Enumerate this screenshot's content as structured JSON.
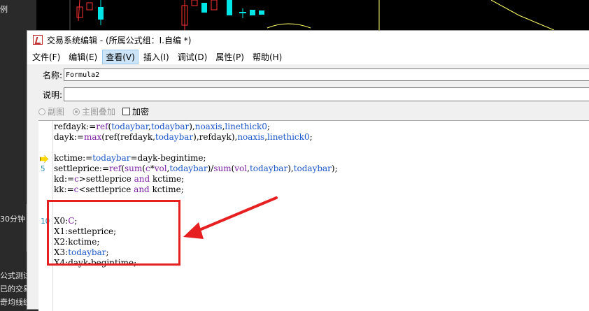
{
  "left_panel": {
    "items": [
      "例",
      "30分钟",
      "公式测试",
      "已的交易",
      "奇均线统"
    ],
    "collapse_glyph": "‹"
  },
  "chart": {
    "background": "#000000",
    "up_color": "#ff3232",
    "down_color": "#00e5e5",
    "line_color": "#ffff66"
  },
  "dialog": {
    "title": "交易系统编辑 - (所属公式组：I.自编 *)",
    "menu": [
      {
        "label": "文件(F)",
        "active": false
      },
      {
        "label": "编辑(E)",
        "active": false
      },
      {
        "label": "查看(V)",
        "active": true
      },
      {
        "label": "插入(I)",
        "active": false
      },
      {
        "label": "调试(D)",
        "active": false
      },
      {
        "label": "属性(P)",
        "active": false
      },
      {
        "label": "帮助(H)",
        "active": false
      }
    ],
    "name_label": "名称:",
    "name_value": "Formula2",
    "desc_label": "说明:",
    "desc_value": "",
    "option_sub_chart": "副图",
    "option_main_overlay": "主图叠加",
    "option_encrypt": "加密"
  },
  "editor": {
    "gutter_numbers": [
      {
        "text": "5"
      },
      {
        "text": "10"
      }
    ],
    "current_line_marker": "arrow-icon",
    "lines": [
      [
        [
          "refdayk:=",
          ""
        ],
        [
          "ref",
          "kw"
        ],
        [
          "(",
          ""
        ],
        [
          "todaybar",
          "id"
        ],
        [
          ",",
          ""
        ],
        [
          "todaybar",
          "id"
        ],
        [
          "),",
          ""
        ],
        [
          "noaxis",
          "id"
        ],
        [
          ",",
          ""
        ],
        [
          "linethick0",
          "id"
        ],
        [
          ";",
          ""
        ]
      ],
      [
        [
          "dayk:=",
          ""
        ],
        [
          "max",
          "kw"
        ],
        [
          "(ref(refdayk,",
          ""
        ],
        [
          "todaybar",
          "id"
        ],
        [
          "),refdayk),",
          ""
        ],
        [
          "noaxis",
          "id"
        ],
        [
          ",",
          ""
        ],
        [
          "linethick0",
          "id"
        ],
        [
          ";",
          ""
        ]
      ],
      [
        [
          "",
          ""
        ]
      ],
      [
        [
          "kctime:=",
          ""
        ],
        [
          "todaybar",
          "id"
        ],
        [
          "=dayk-begintime;",
          ""
        ]
      ],
      [
        [
          "settleprice:=",
          ""
        ],
        [
          "ref",
          "kw"
        ],
        [
          "(",
          ""
        ],
        [
          "sum",
          "kw"
        ],
        [
          "(",
          ""
        ],
        [
          "c",
          "kw"
        ],
        [
          "*",
          ""
        ],
        [
          "vol",
          "kw"
        ],
        [
          ",",
          ""
        ],
        [
          "todaybar",
          "id"
        ],
        [
          ")/",
          ""
        ],
        [
          "sum",
          "kw"
        ],
        [
          "(",
          ""
        ],
        [
          "vol",
          "kw"
        ],
        [
          ",",
          ""
        ],
        [
          "todaybar",
          "id"
        ],
        [
          "),",
          ""
        ],
        [
          "todaybar",
          "id"
        ],
        [
          ");",
          ""
        ]
      ],
      [
        [
          "kd:=",
          ""
        ],
        [
          "c",
          "kw"
        ],
        [
          ">settleprice ",
          ""
        ],
        [
          "and",
          "kw"
        ],
        [
          " kctime;",
          ""
        ]
      ],
      [
        [
          "kk:=",
          ""
        ],
        [
          "c",
          "kw"
        ],
        [
          "<settleprice ",
          ""
        ],
        [
          "and",
          "kw"
        ],
        [
          " kctime;",
          ""
        ]
      ],
      [
        [
          "",
          ""
        ]
      ],
      [
        [
          "",
          ""
        ]
      ],
      [
        [
          "X0:",
          ""
        ],
        [
          "C",
          "kw"
        ],
        [
          ";",
          ""
        ]
      ],
      [
        [
          "X1:settleprice;",
          ""
        ]
      ],
      [
        [
          "X2:kctime;",
          ""
        ]
      ],
      [
        [
          "X3:",
          ""
        ],
        [
          "todaybar",
          "id"
        ],
        [
          ";",
          ""
        ]
      ],
      [
        [
          "X4:dayk-begintime;",
          ""
        ]
      ]
    ]
  },
  "annotation": {
    "box_color": "#e62020"
  }
}
